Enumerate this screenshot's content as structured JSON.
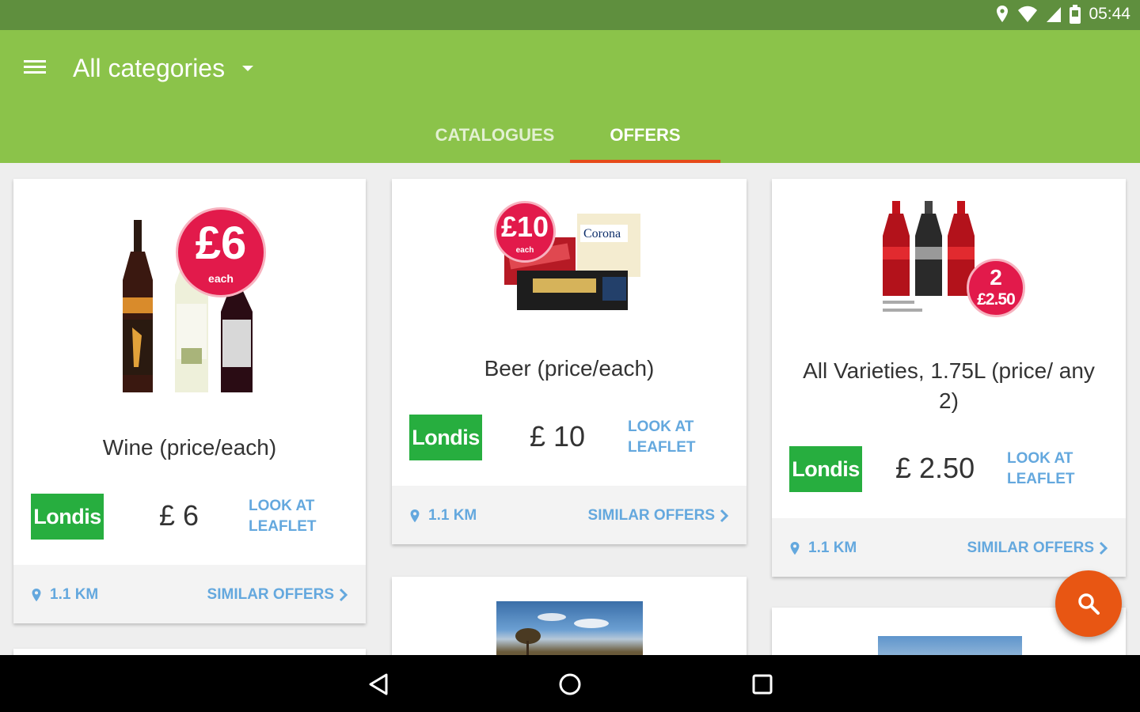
{
  "status_bar": {
    "time": "05:44",
    "icons": [
      "location-icon",
      "wifi-icon",
      "signal-icon",
      "battery-icon"
    ]
  },
  "app_bar": {
    "category_title": "All categories",
    "tabs": [
      {
        "label": "CATALOGUES",
        "active": false
      },
      {
        "label": "OFFERS",
        "active": true
      }
    ]
  },
  "offers": [
    {
      "title": "Wine (price/each)",
      "store": "Londis",
      "price": "£ 6",
      "look_label": "LOOK AT LEAFLET",
      "distance": "1.1 KM",
      "similar_label": "SIMILAR OFFERS",
      "badge_main": "£6",
      "badge_sub": "each"
    },
    {
      "title": "Beer (price/each)",
      "store": "Londis",
      "price": "£ 10",
      "look_label": "LOOK AT LEAFLET",
      "distance": "1.1 KM",
      "similar_label": "SIMILAR OFFERS",
      "badge_main": "£10",
      "badge_sub": "each",
      "pack_text": "Corona"
    },
    {
      "title": "All Varieties, 1.75L (price/ any 2)",
      "store": "Londis",
      "price": "£ 2.50",
      "look_label": "LOOK AT LEAFLET",
      "distance": "1.1 KM",
      "similar_label": "SIMILAR OFFERS",
      "badge_main": "2",
      "badge_sub": "£2.50"
    }
  ],
  "colors": {
    "appbar": "#8bc34a",
    "statusbar": "#5f8f3e",
    "accent": "#e64a19",
    "fab": "#e85613",
    "link": "#64a8de",
    "store": "#27ae3f",
    "badge": "#e21a4b"
  },
  "fab": {
    "icon": "search-icon"
  },
  "nav": {
    "icons": [
      "back-icon",
      "home-icon",
      "recents-icon"
    ]
  }
}
